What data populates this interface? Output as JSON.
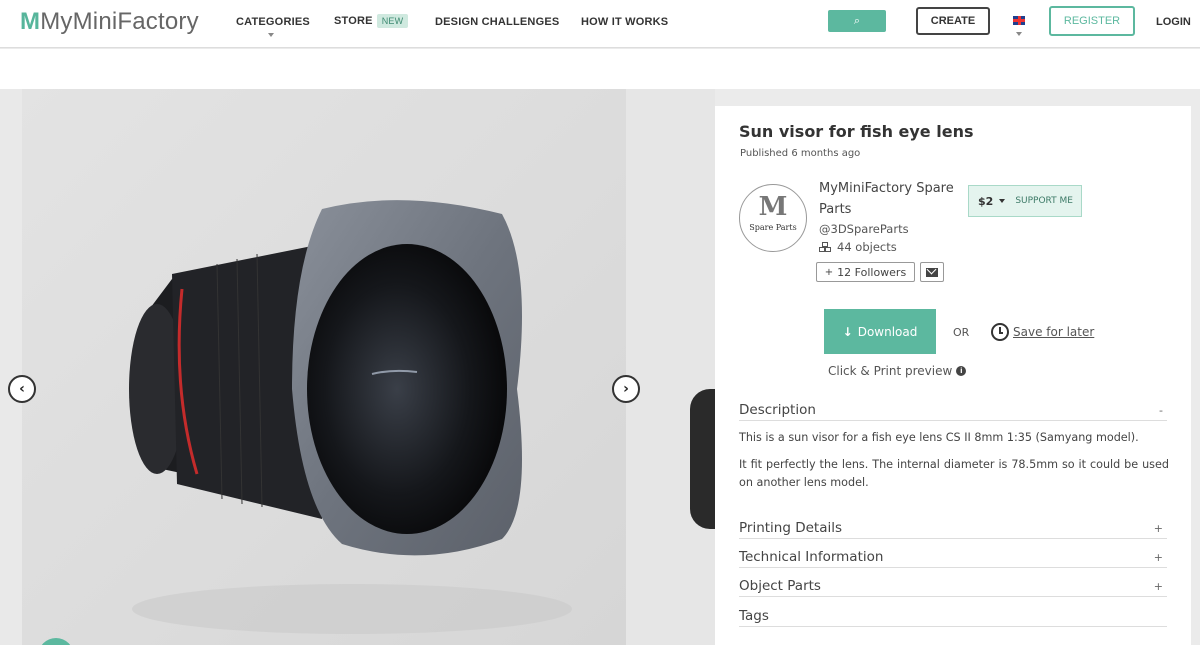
{
  "header": {
    "logo_text": "MyMiniFactory",
    "nav": {
      "categories": "CATEGORIES",
      "store": "STORE",
      "store_badge": "NEW",
      "design_challenges": "DESIGN CHALLENGES",
      "how_it_works": "HOW IT WORKS"
    },
    "search_icon": "⌕",
    "create": "CREATE",
    "register": "REGISTER",
    "login": "LOGIN"
  },
  "gallery": {
    "prev_icon": "‹",
    "next_icon": "›"
  },
  "object": {
    "title": "Sun visor for fish eye lens",
    "published": "Published 6 months ago",
    "creator": {
      "avatar_letter": "M",
      "avatar_caption": "Spare Parts",
      "name": "MyMiniFactory Spare Parts",
      "handle": "@3DSpareParts",
      "objects": "44 objects",
      "followers": "12 Followers"
    },
    "support": {
      "price": "$2",
      "label": "SUPPORT ME"
    },
    "download": "Download",
    "or": "OR",
    "save_later": "Save for later",
    "preview": "Click & Print preview"
  },
  "sections": {
    "description": {
      "title": "Description",
      "toggle": "-"
    },
    "description_p1": "This is a sun visor for a fish eye lens CS II 8mm 1:35 (Samyang model).",
    "description_p2": "It fit perfectly the lens. The internal diameter is 78.5mm so it could be used on another lens model.",
    "printing_details": {
      "title": "Printing Details",
      "toggle": "+"
    },
    "technical_information": {
      "title": "Technical Information",
      "toggle": "+"
    },
    "object_parts": {
      "title": "Object Parts",
      "toggle": "+"
    },
    "tags": {
      "title": "Tags"
    }
  }
}
